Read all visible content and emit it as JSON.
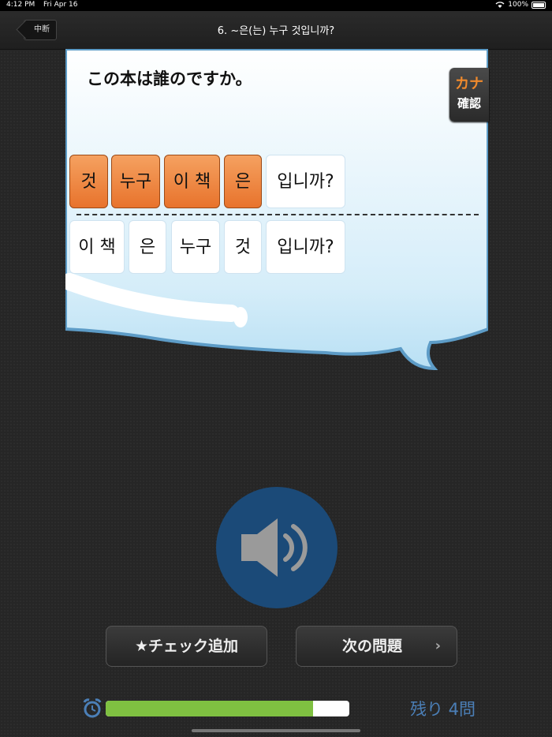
{
  "status_bar": {
    "time": "4:12 PM",
    "date": "Fri Apr 16",
    "battery": "100%"
  },
  "nav": {
    "back_label": "中断",
    "title": "6. ~은(는) 누구 것입니까?"
  },
  "question": {
    "text": "この本は誰のですか。"
  },
  "kana_button": {
    "line1": "カナ",
    "line2": "確認"
  },
  "answer_row": [
    "것",
    "누구",
    "이 책",
    "은",
    "입니까?"
  ],
  "choice_row": [
    "이 책",
    "은",
    "누구",
    "것",
    "입니까?"
  ],
  "buttons": {
    "check": "★チェック追加",
    "next": "次の問題",
    "next_chevron": "›"
  },
  "progress": {
    "value": 0.85,
    "remaining": "残り 4問"
  },
  "colors": {
    "tile_active": "#e8732c",
    "sound_button": "#1b4a78",
    "progress_fill": "#7fc041",
    "remaining_text": "#4b7fb7"
  }
}
